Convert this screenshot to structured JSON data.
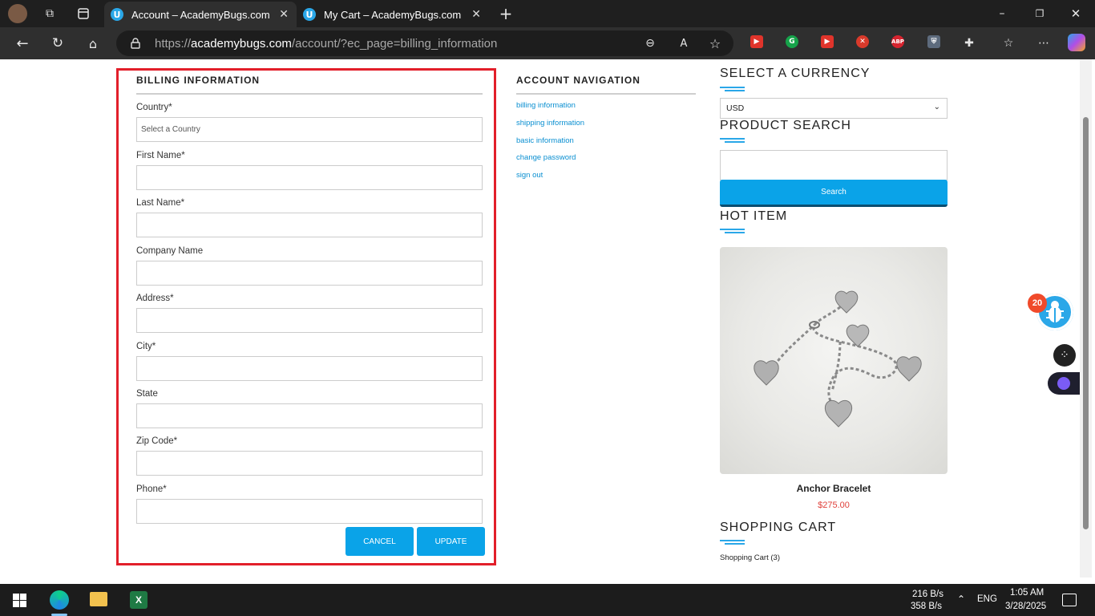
{
  "browser": {
    "tabs": [
      {
        "title": "Account – AcademyBugs.com",
        "favicon": "U",
        "active": true
      },
      {
        "title": "My Cart – AcademyBugs.com",
        "favicon": "U",
        "active": false
      }
    ],
    "url_prefix": "https://",
    "url_host": "academybugs.com",
    "url_path": "/account/?ec_page=billing_information"
  },
  "billing": {
    "title": "BILLING INFORMATION",
    "country_label": "Country*",
    "country_placeholder": "Select a Country",
    "first_name_label": "First Name*",
    "last_name_label": "Last Name*",
    "company_label": "Company Name",
    "address_label": "Address*",
    "city_label": "City*",
    "state_label": "State",
    "zip_label": "Zip Code*",
    "phone_label": "Phone*",
    "cancel_label": "CANCEL",
    "update_label": "UPDATE"
  },
  "account_nav": {
    "title": "ACCOUNT NAVIGATION",
    "links": [
      "billing information",
      "shipping information",
      "basic information",
      "change password",
      "sign out"
    ]
  },
  "sidebar": {
    "currency_title": "SELECT A CURRENCY",
    "currency_value": "USD",
    "search_title": "PRODUCT SEARCH",
    "search_button": "Search",
    "hot_title": "HOT ITEM",
    "product_name": "Anchor Bracelet",
    "product_price": "$275.00",
    "cart_title": "SHOPPING CART",
    "cart_link": "Shopping Cart (3)"
  },
  "bug_widget": {
    "count": "20"
  },
  "taskbar": {
    "net_up": "216 B/s",
    "net_down": "358 B/s",
    "lang": "ENG",
    "time": "1:05 AM",
    "date": "3/28/2025"
  },
  "colors": {
    "accent": "#0aa3e8",
    "highlight_border": "#e21f2a",
    "price": "#e0413b"
  }
}
